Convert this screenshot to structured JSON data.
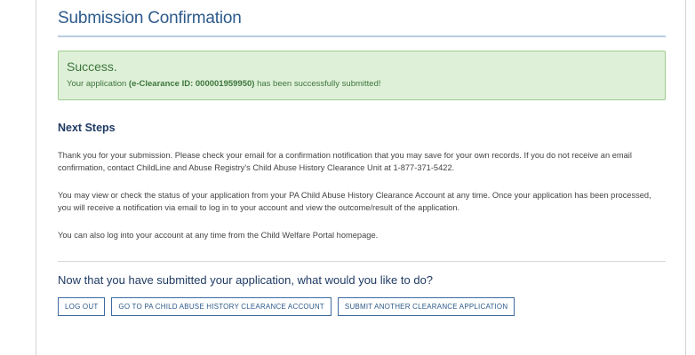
{
  "page": {
    "title": "Submission Confirmation"
  },
  "success": {
    "heading": "Success.",
    "message_prefix": "Your application ",
    "message_id": "(e-Clearance ID: 000001959950)",
    "message_suffix": " has been successfully submitted!"
  },
  "next_steps": {
    "heading": "Next Steps",
    "paragraphs": [
      "Thank you for your submission. Please check your email for a confirmation notification that you may save for your own records. If you do not receive an email confirmation, contact ChildLine and Abuse Registry's Child Abuse History Clearance Unit at 1-877-371-5422.",
      "You may view or check the status of your application from your PA Child Abuse History Clearance Account at any time. Once your application has been processed, you will receive a notification via email to log in to your account and view the outcome/result of the application.",
      "You can also log into your account at any time from the Child Welfare Portal homepage."
    ]
  },
  "actions": {
    "question": "Now that you have submitted your application, what would you like to do?",
    "log_out_label": "LOG OUT",
    "go_to_account_label": "GO TO PA CHILD ABUSE HISTORY CLEARANCE ACCOUNT",
    "submit_another_label": "SUBMIT ANOTHER CLEARANCE APPLICATION"
  },
  "colors": {
    "title": "#2c5a8c",
    "success_bg": "#dff0d8",
    "success_border": "#9ccb8c",
    "success_text": "#3c763d",
    "heading": "#1f3b64",
    "button_border": "#3e6a9e"
  }
}
